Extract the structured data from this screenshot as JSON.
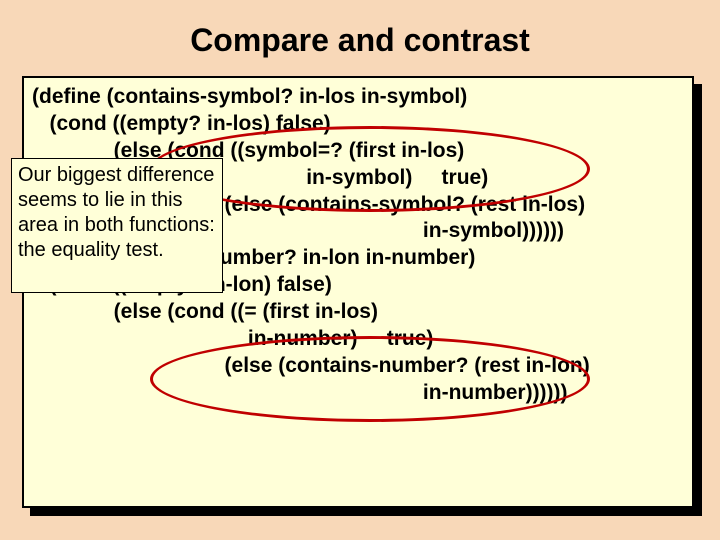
{
  "title": "Compare and contrast",
  "code": {
    "l1": "(define (contains-symbol? in-los in-symbol)",
    "l2": "   (cond ((empty? in-los) false)",
    "l3": "              (else (cond ((symbol=? (first in-los)",
    "l4": "                                               in-symbol)     true)",
    "l5": "                                 (else (contains-symbol? (rest in-los)",
    "l6": "                                                                   in-symbol))))))",
    "l7": "(define (contains-number? in-lon in-number)",
    "l8": "   (cond ((empty? in-lon) false)",
    "l9": "              (else (cond ((= (first in-los)",
    "l10": "                                     in-number)     true)",
    "l11": "                                 (else (contains-number? (rest in-lon)",
    "l12": "                                                                   in-number))))))"
  },
  "callout": "Our biggest difference seems to lie in this area in both functions:  the equality test."
}
